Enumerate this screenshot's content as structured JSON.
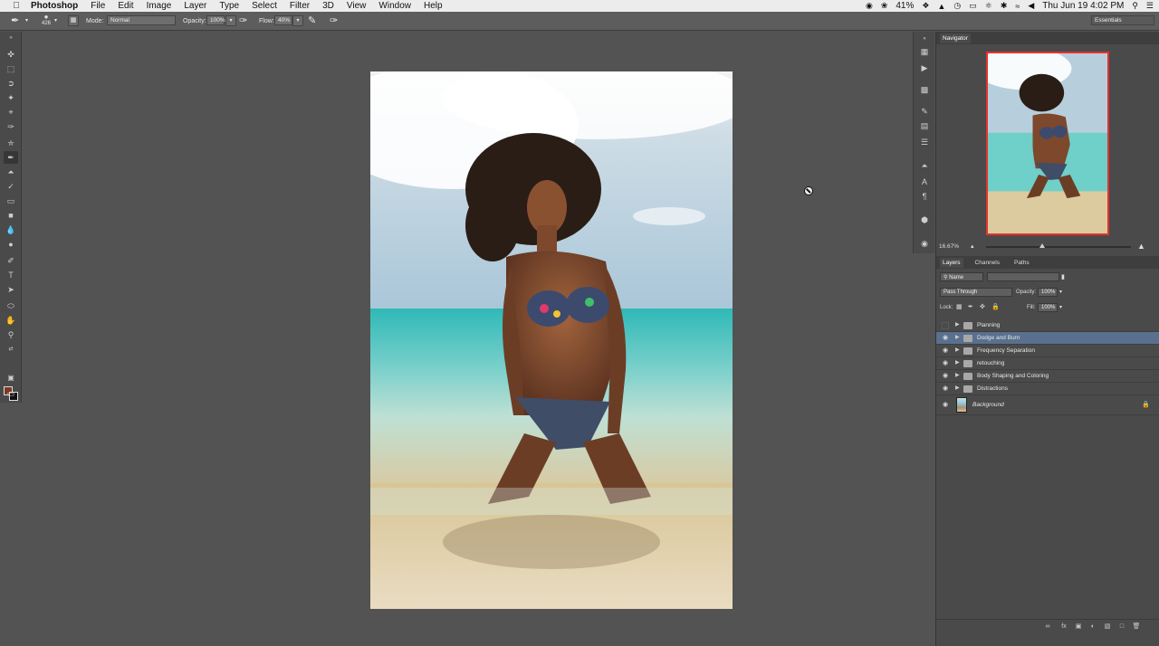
{
  "menubar": {
    "apple": "",
    "app": "Photoshop",
    "items": [
      "File",
      "Edit",
      "Image",
      "Layer",
      "Type",
      "Select",
      "Filter",
      "3D",
      "View",
      "Window",
      "Help"
    ],
    "battery": "41%",
    "clock": "Thu Jun 19  4:02 PM"
  },
  "options": {
    "brush_size": "426",
    "mode_label": "Mode:",
    "mode_value": "Normal",
    "opacity_label": "Opacity:",
    "opacity_value": "100%",
    "flow_label": "Flow:",
    "flow_value": "40%",
    "workspace": "Essentials"
  },
  "navigator": {
    "tab": "Navigator",
    "zoom": "16.67%"
  },
  "layers_panel": {
    "tabs": [
      "Layers",
      "Channels",
      "Paths"
    ],
    "filter_kind": "Name",
    "blend_mode": "Pass Through",
    "opacity_label": "Opacity:",
    "opacity_value": "100%",
    "lock_label": "Lock:",
    "fill_label": "Fill:",
    "fill_value": "100%",
    "layers": [
      {
        "name": "Planning",
        "visible": false,
        "type": "group"
      },
      {
        "name": "Dodge and Burn",
        "visible": true,
        "type": "group",
        "selected": true
      },
      {
        "name": "Frequency Separation",
        "visible": true,
        "type": "group"
      },
      {
        "name": "retouching",
        "visible": true,
        "type": "group"
      },
      {
        "name": "Body Shaping and Coloring",
        "visible": true,
        "type": "group"
      },
      {
        "name": "Distractions",
        "visible": true,
        "type": "group"
      },
      {
        "name": "Background",
        "visible": true,
        "type": "image"
      }
    ]
  },
  "colors": {
    "foreground": "#7a3b23",
    "background": "#111111",
    "selection": "#59708f",
    "navigator_frame": "#e5322d"
  }
}
